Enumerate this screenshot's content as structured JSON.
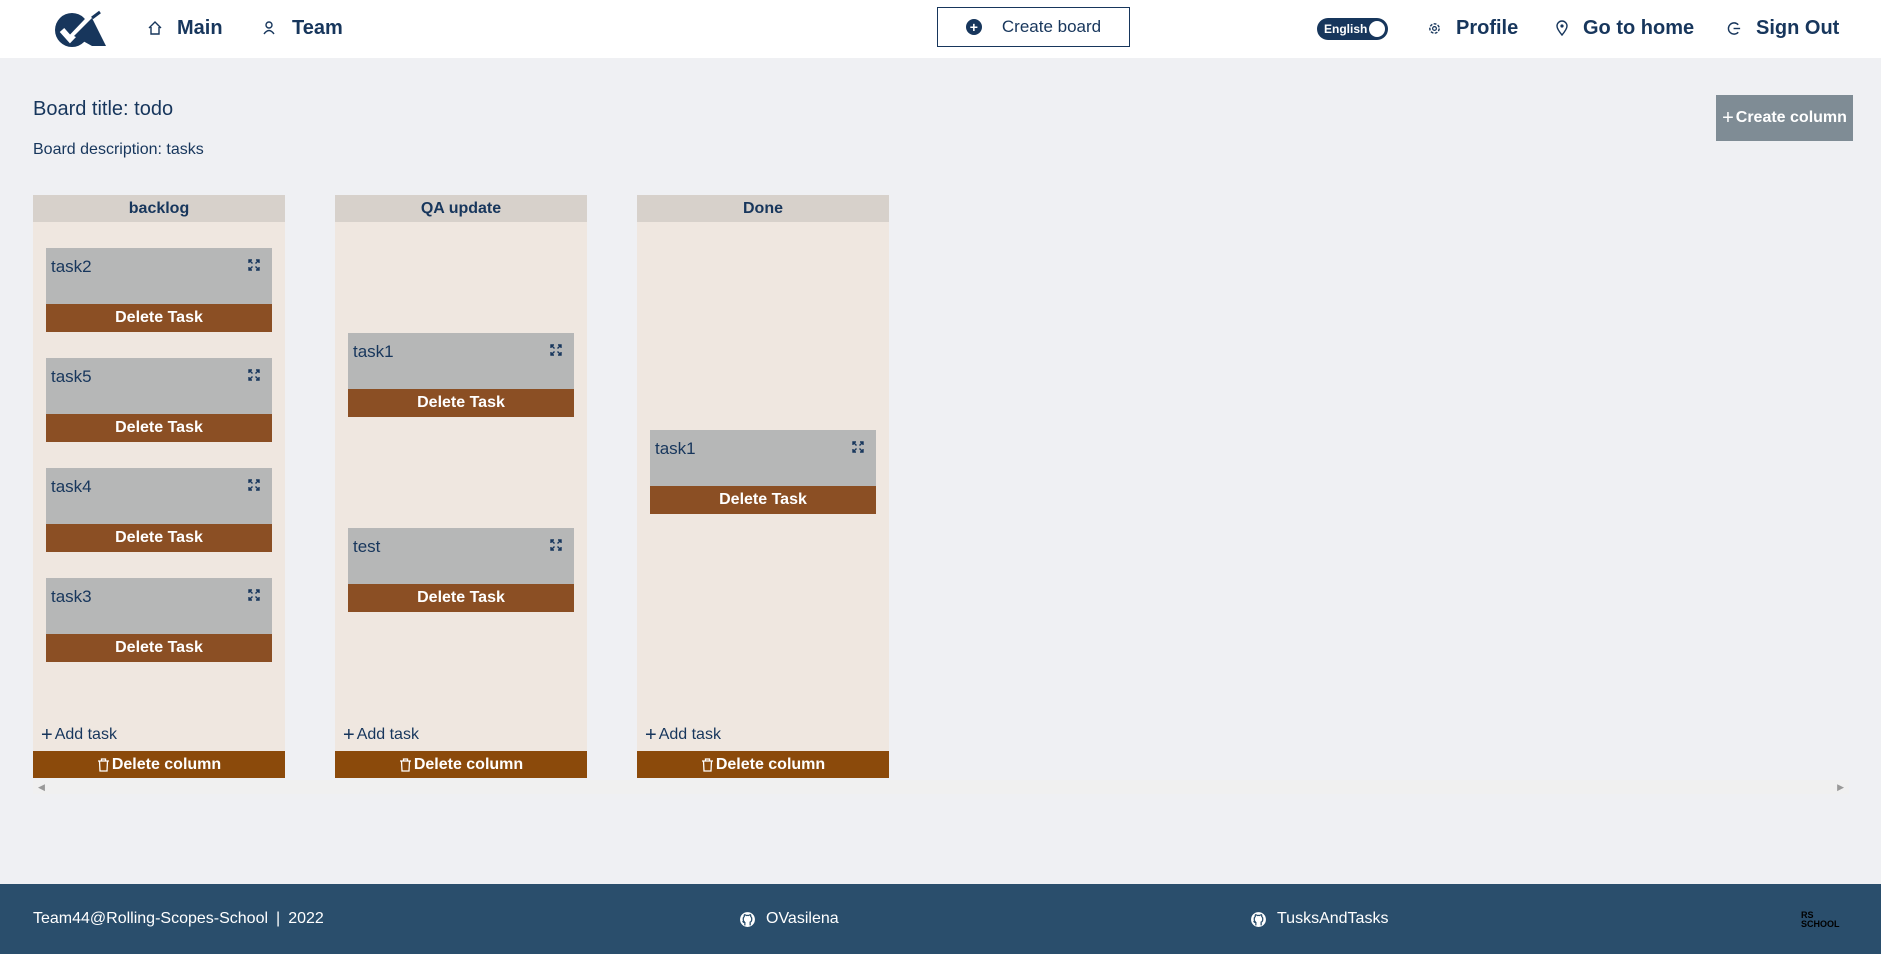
{
  "header": {
    "nav": {
      "main": "Main",
      "team": "Team"
    },
    "create_board": "Create board",
    "language": "English",
    "profile": "Profile",
    "go_home": "Go to home",
    "sign_out": "Sign Out"
  },
  "board": {
    "title": "Board title: todo",
    "description": "Board description: tasks",
    "create_column": "Create column"
  },
  "columns": [
    {
      "title": "backlog",
      "tasks": [
        {
          "title": "task2"
        },
        {
          "title": "task5"
        },
        {
          "title": "task4"
        },
        {
          "title": "task3"
        }
      ],
      "add_task": "Add task",
      "delete_column": "Delete column"
    },
    {
      "title": "QA update",
      "tasks": [
        {
          "title": "task1"
        },
        {
          "title": "test"
        }
      ],
      "add_task": "Add task",
      "delete_column": "Delete column"
    },
    {
      "title": "Done",
      "tasks": [
        {
          "title": "task1"
        }
      ],
      "add_task": "Add task",
      "delete_column": "Delete column"
    }
  ],
  "delete_task_label": "Delete Task",
  "footer": {
    "team": "Team44@Rolling-Scopes-School",
    "year": "2022",
    "github_user": "OVasilena",
    "github_repo": "TusksAndTasks",
    "school_logo_text": "RS SCHOOL"
  },
  "colors": {
    "primary": "#17365c",
    "delete_task": "#8b4f24",
    "delete_column": "#8b4a0b",
    "footer": "#2a4e6c",
    "task_card": "#b6b7b7",
    "column_bg": "#efe7e0"
  }
}
